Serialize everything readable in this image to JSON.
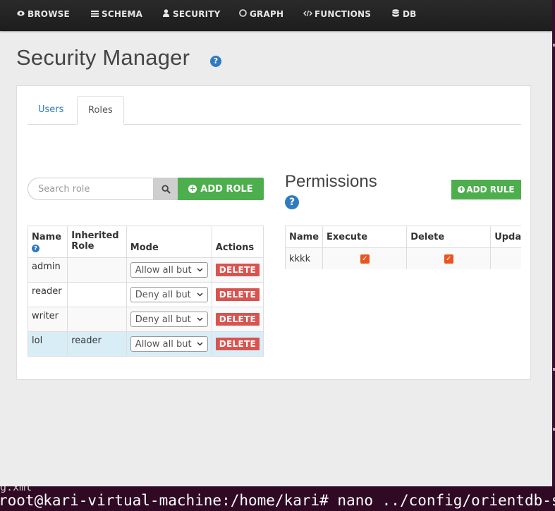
{
  "nav": {
    "items": [
      {
        "label": "BROWSE",
        "icon": "eye-icon"
      },
      {
        "label": "SCHEMA",
        "icon": "list-icon"
      },
      {
        "label": "SECURITY",
        "icon": "user-icon"
      },
      {
        "label": "GRAPH",
        "icon": "circle-icon"
      },
      {
        "label": "FUNCTIONS",
        "icon": "code-icon"
      },
      {
        "label": "DB",
        "icon": "database-icon"
      }
    ]
  },
  "page": {
    "title": "Security Manager",
    "help": "?"
  },
  "tabs": [
    {
      "label": "Users",
      "active": false
    },
    {
      "label": "Roles",
      "active": true
    }
  ],
  "roles": {
    "search_placeholder": "Search role",
    "add_label": "ADD ROLE",
    "columns": [
      "Name",
      "Inherited Role",
      "Mode",
      "Actions"
    ],
    "rows": [
      {
        "name": "admin",
        "inherited": "",
        "mode": "Allow all but",
        "action": "DELETE"
      },
      {
        "name": "reader",
        "inherited": "",
        "mode": "Deny all but",
        "action": "DELETE"
      },
      {
        "name": "writer",
        "inherited": "",
        "mode": "Deny all but",
        "action": "DELETE"
      },
      {
        "name": "lol",
        "inherited": "reader",
        "mode": "Allow all but",
        "action": "DELETE"
      }
    ]
  },
  "permissions": {
    "title": "Permissions",
    "add_label": "ADD RULE",
    "columns": [
      "Name",
      "Execute",
      "Delete",
      "Update"
    ],
    "rows": [
      {
        "name": "kkkk",
        "execute": true,
        "delete": true
      }
    ]
  },
  "terminal": {
    "prev_line": "g.xml",
    "prompt": "root@kari-virtual-machine:/home/kari# nano ../config/orientdb-server-config.xml"
  },
  "colors": {
    "accent_green": "#4cae4c",
    "danger_red": "#d9534f",
    "checkbox_orange": "#e95420",
    "link_blue": "#337ab7"
  }
}
